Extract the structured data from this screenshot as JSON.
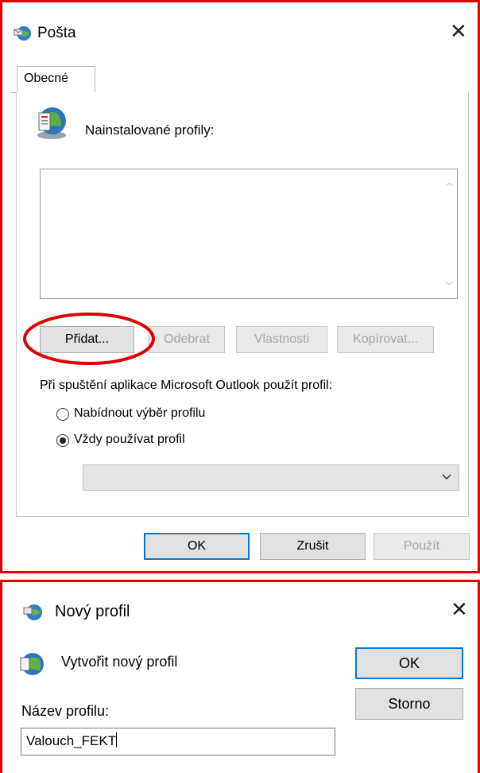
{
  "mail_dialog": {
    "title": "Pošta",
    "tab": "Obecné",
    "installed_profiles_label": "Nainstalované profily:",
    "buttons": {
      "add": "Přidat...",
      "remove": "Odebrat",
      "properties": "Vlastnosti",
      "copy": "Kopírovat..."
    },
    "startup_label": "Při spuštění aplikace Microsoft Outlook použít profil:",
    "radio_prompt": "Nabídnout výběr profilu",
    "radio_always": "Vždy používat profil",
    "ok": "OK",
    "cancel": "Zrušit",
    "apply": "Použít"
  },
  "new_profile_dialog": {
    "title": "Nový profil",
    "heading": "Vytvořit nový profil",
    "name_label": "Název profilu:",
    "name_value": "Valouch_FEKT",
    "ok": "OK",
    "cancel": "Storno"
  },
  "colors": {
    "highlight_frame": "#e00000",
    "annotation_circle": "#e00000",
    "default_button_border": "#0078d7"
  },
  "icons": [
    "mail-globe-icon",
    "close-icon",
    "scroll-up-icon",
    "scroll-down-icon",
    "dropdown-chevron-icon"
  ]
}
